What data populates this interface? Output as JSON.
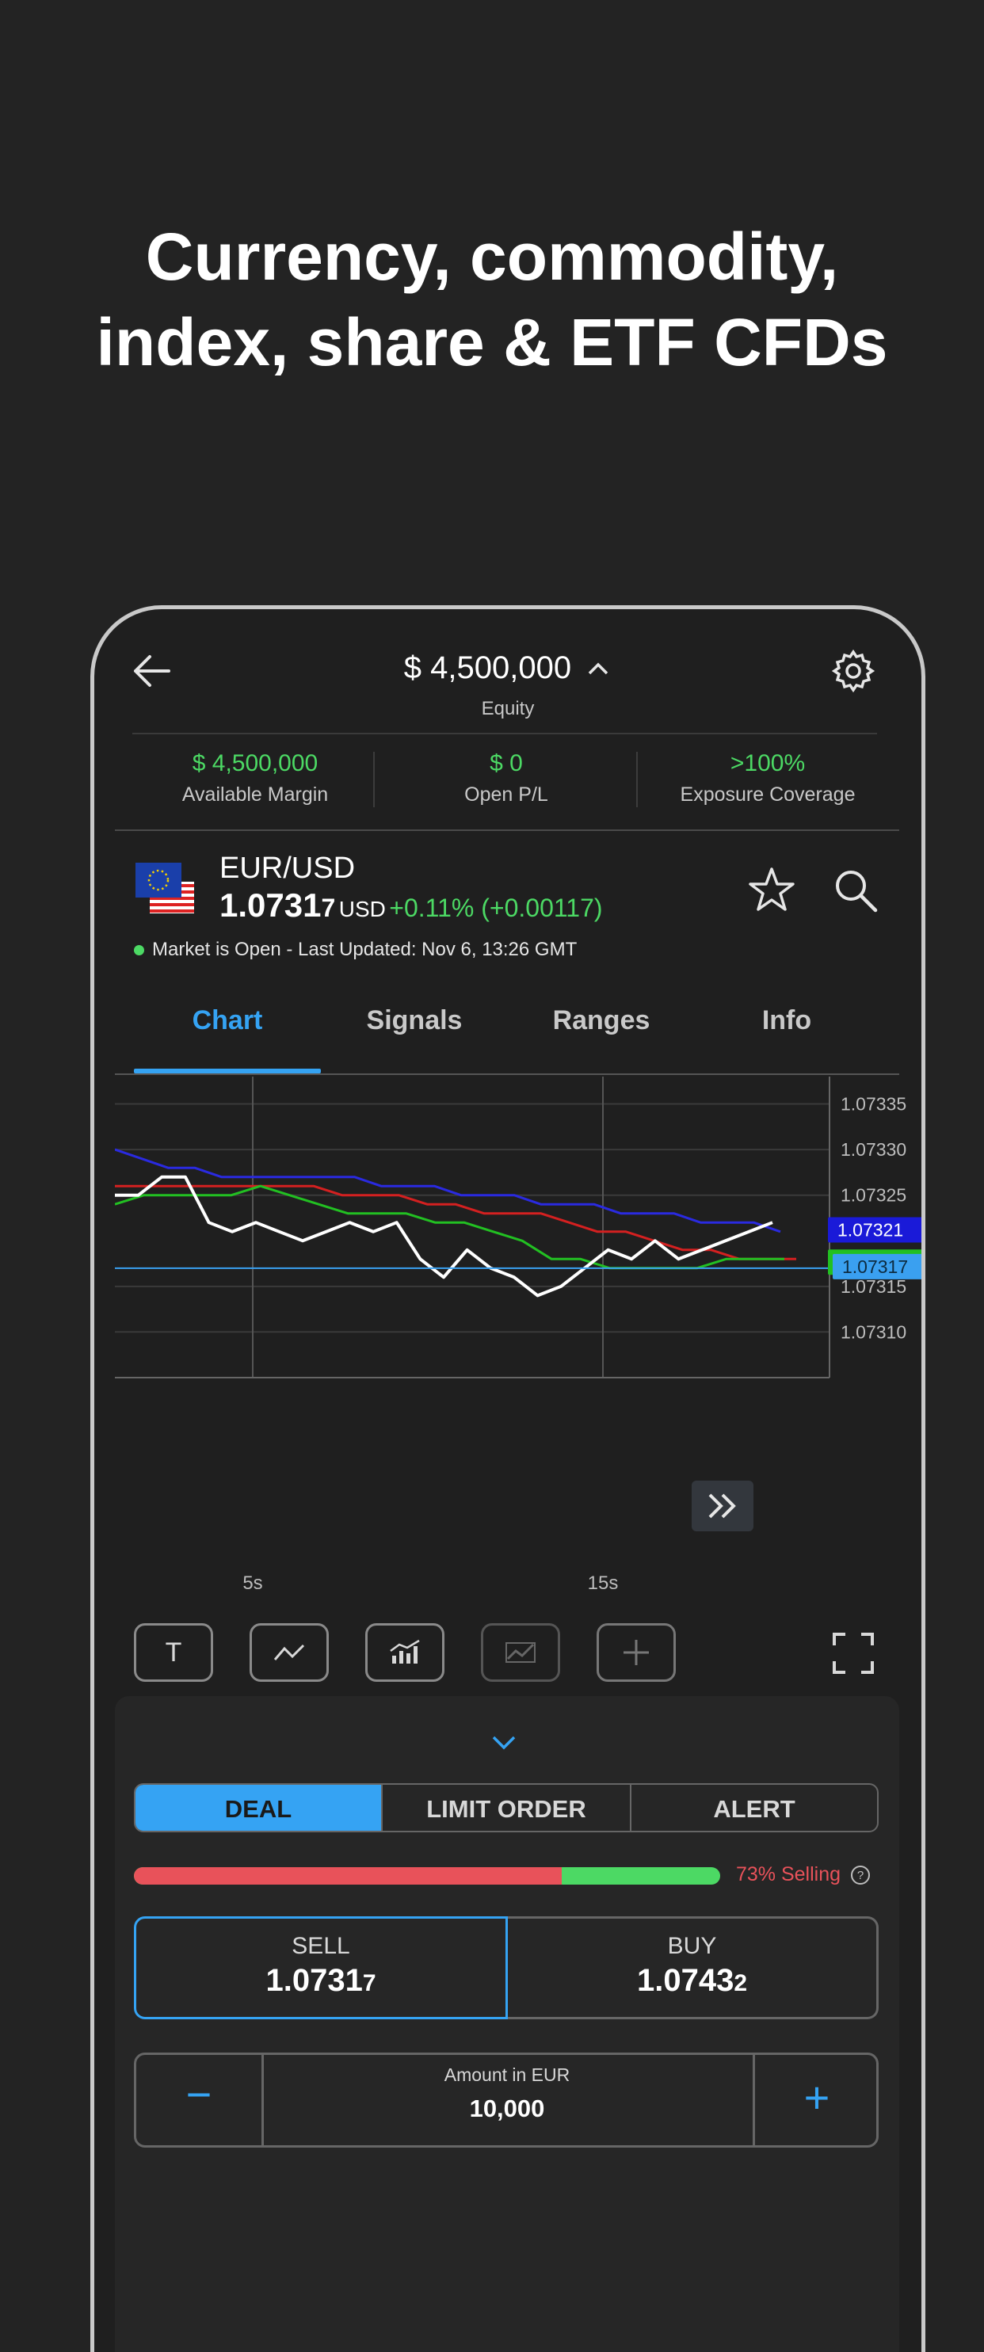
{
  "promo": {
    "line1": "Currency, commodity,",
    "line2": "index, share & ETF CFDs"
  },
  "header": {
    "back_icon": "arrow-left-icon",
    "equity_amount": "$ 4,500,000",
    "expand_icon": "chevron-up-icon",
    "equity_label": "Equity",
    "settings_icon": "gear-icon"
  },
  "stats": [
    {
      "value": "$ 4,500,000",
      "label": "Available Margin"
    },
    {
      "value": "$ 0",
      "label": "Open P/L"
    },
    {
      "value": ">100%",
      "label": "Exposure Coverage"
    }
  ],
  "instrument": {
    "pair": "EUR/USD",
    "price_main": "1.0731",
    "price_pip": "7",
    "currency": "USD",
    "change": "+0.11% (+0.00117)",
    "status": "Market is Open - Last Updated: Nov 6, 13:26 GMT",
    "status_color": "#4cd964",
    "favorite_icon": "star-icon",
    "search_icon": "search-icon",
    "flag_icon": "eu-us-flag-icon"
  },
  "tabs": [
    {
      "label": "Chart",
      "active": true
    },
    {
      "label": "Signals",
      "active": false
    },
    {
      "label": "Ranges",
      "active": false
    },
    {
      "label": "Info",
      "active": false
    }
  ],
  "chart_data": {
    "type": "line",
    "x_tick_labels": [
      "5s",
      "15s"
    ],
    "y_tick_labels": [
      "1.07335",
      "1.07330",
      "1.07325",
      "1.07315",
      "1.07310"
    ],
    "ylim": [
      1.07305,
      1.07338
    ],
    "series": [
      {
        "color": "#ffffff",
        "values": [
          1.07325,
          1.07325,
          1.07327,
          1.07327,
          1.07322,
          1.07321,
          1.07322,
          1.07321,
          1.0732,
          1.07321,
          1.07322,
          1.07321,
          1.07322,
          1.07318,
          1.07316,
          1.07319,
          1.07317,
          1.07316,
          1.07314,
          1.07315,
          1.07317,
          1.07319,
          1.07318,
          1.0732,
          1.07318,
          1.07319,
          1.0732,
          1.07321,
          1.07322
        ]
      },
      {
        "color": "#2a2ae0",
        "values": [
          1.0733,
          1.07329,
          1.07328,
          1.07328,
          1.07327,
          1.07327,
          1.07327,
          1.07327,
          1.07327,
          1.07327,
          1.07326,
          1.07326,
          1.07326,
          1.07325,
          1.07325,
          1.07325,
          1.07324,
          1.07324,
          1.07324,
          1.07323,
          1.07323,
          1.07323,
          1.07322,
          1.07322,
          1.07322,
          1.07321
        ]
      },
      {
        "color": "#d42020",
        "values": [
          1.07326,
          1.07326,
          1.07326,
          1.07326,
          1.07326,
          1.07326,
          1.07326,
          1.07326,
          1.07325,
          1.07325,
          1.07325,
          1.07324,
          1.07324,
          1.07323,
          1.07323,
          1.07323,
          1.07322,
          1.07321,
          1.07321,
          1.0732,
          1.07319,
          1.07319,
          1.07318,
          1.07318,
          1.07318
        ]
      },
      {
        "color": "#22c022",
        "values": [
          1.07324,
          1.07325,
          1.07325,
          1.07325,
          1.07325,
          1.07326,
          1.07325,
          1.07324,
          1.07323,
          1.07323,
          1.07323,
          1.07322,
          1.07322,
          1.07321,
          1.0732,
          1.07318,
          1.07318,
          1.07317,
          1.07317,
          1.07317,
          1.07317,
          1.07318,
          1.07318,
          1.07318
        ]
      },
      {
        "color": "#3aa0f0",
        "values": [
          1.07317,
          1.07317
        ]
      }
    ],
    "price_tags": [
      {
        "label": "1.07321",
        "color": "#1a1ad8"
      },
      {
        "label": "1.07318",
        "color": "#22c022"
      },
      {
        "label": "1.07317",
        "color": "#3aa0f0"
      }
    ],
    "grid": true
  },
  "tools": [
    {
      "icon": "text-tool-icon",
      "glyph": "T"
    },
    {
      "icon": "line-tool-icon"
    },
    {
      "icon": "indicator-chart-icon"
    },
    {
      "icon": "compare-chart-icon"
    },
    {
      "icon": "crosshair-plus-icon"
    },
    {
      "icon": "fullscreen-icon"
    }
  ],
  "order": {
    "collapse_icon": "chevron-down-icon",
    "segments": [
      "DEAL",
      "LIMIT ORDER",
      "ALERT"
    ],
    "sentiment": {
      "selling_fraction": 0.73,
      "label": "73% Selling",
      "help_icon": "question-circle-icon"
    },
    "sell": {
      "label": "SELL",
      "price_main": "1.0731",
      "price_pip": "7"
    },
    "buy": {
      "label": "BUY",
      "price_main": "1.0743",
      "price_pip": "2"
    },
    "amount_label": "Amount in EUR",
    "amount_value": "10,000",
    "minus": "−",
    "plus": "+"
  },
  "colors": {
    "accent": "#35a3f3",
    "positive": "#4cd964",
    "negative": "#e8525a",
    "background": "#232323"
  }
}
